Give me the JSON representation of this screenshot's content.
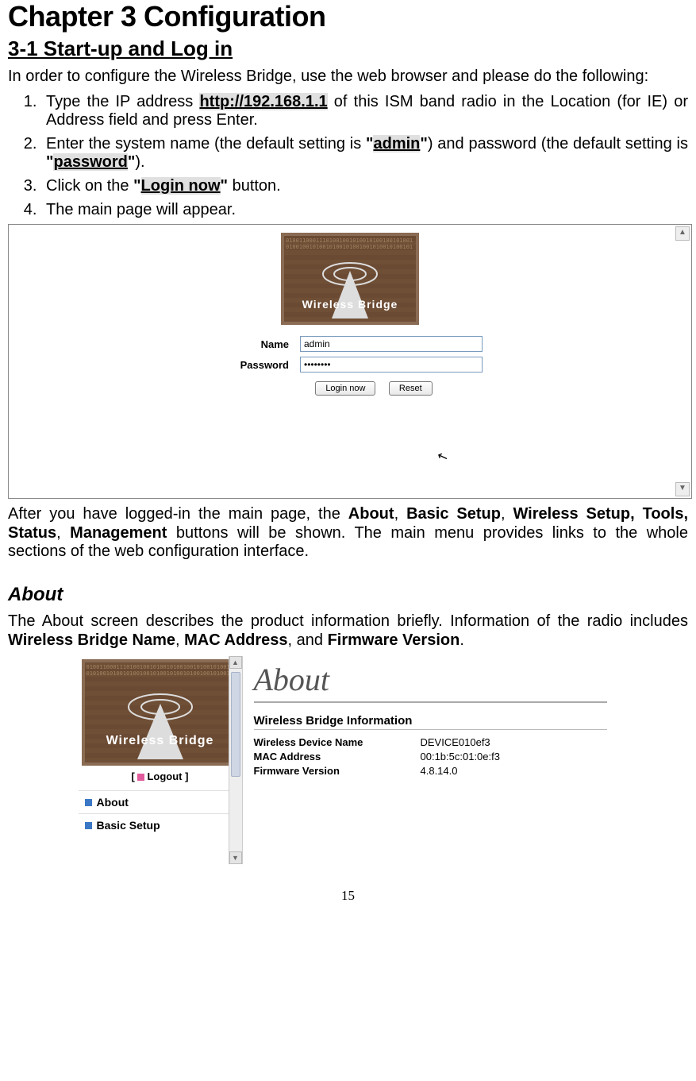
{
  "chapter_title": "Chapter 3    Configuration",
  "section_title": "3-1 Start-up and Log in",
  "intro": "In order to configure the Wireless Bridge, use the web browser and please do the following:",
  "steps": {
    "s1a": "Type the IP address ",
    "s1_link": "http://192.168.1.1",
    "s1b": " of this ISM band radio in the Location (for IE) or Address field and press Enter.",
    "s2a": "Enter the system name (the default setting is ",
    "s2_q1": "\"",
    "s2_admin": "admin",
    "s2_q2": "\"",
    "s2b": ") and password (the default setting is ",
    "s2_q3": "\"",
    "s2_pw": "password",
    "s2_q4": "\"",
    "s2c": ").",
    "s3a": "Click on the ",
    "s3_q1": "\"",
    "s3_btn": "Login now",
    "s3_q2": "\"",
    "s3b": " button.",
    "s4": "The main page will appear."
  },
  "login_shot": {
    "logo_band": "Wireless  Bridge",
    "name_label": "Name",
    "name_value": "admin",
    "pw_label": "Password",
    "pw_value": "••••••••",
    "btn_login": "Login now",
    "btn_reset": "Reset"
  },
  "after_login_a": "After you have logged-in the main page, the ",
  "after_login_bold": "About",
  "after_login_sep1": ", ",
  "after_login_b2": "Basic Setup",
  "after_login_sep2": ", ",
  "after_login_b3": "Wireless Setup, Tools, Status",
  "after_login_sep3": ", ",
  "after_login_b4": "Management",
  "after_login_b": " buttons will be shown. The main menu provides links to the whole sections of the web configuration interface.",
  "about_heading": "About",
  "about_text_a": "The About screen describes the product information briefly. Information of the radio includes ",
  "about_b1": "Wireless Bridge Name",
  "about_s1": ", ",
  "about_b2": "MAC Address",
  "about_s2": ", and ",
  "about_b3": "Firmware Version",
  "about_s3": ".",
  "about_shot": {
    "logo_band": "Wireless  Bridge",
    "logout_open": "[  ",
    "logout_label": "Logout",
    "logout_close": " ]",
    "nav_about": "About",
    "nav_basic": "Basic Setup",
    "panel_title": "About",
    "panel_sub": "Wireless Bridge Information",
    "rows": [
      {
        "k": "Wireless Device Name",
        "v": "DEVICE010ef3"
      },
      {
        "k": "MAC Address",
        "v": "00:1b:5c:01:0e:f3"
      },
      {
        "k": "Firmware Version",
        "v": "4.8.14.0"
      }
    ]
  },
  "page_number": "15"
}
